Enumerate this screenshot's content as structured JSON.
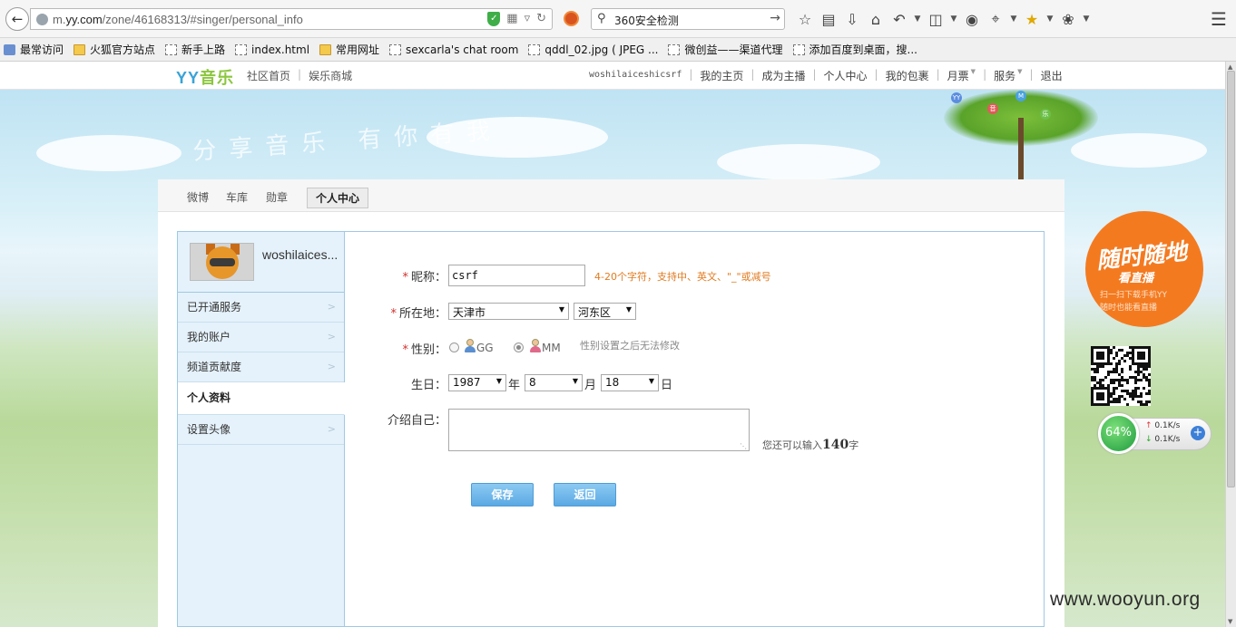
{
  "browser": {
    "url_prefix": "m.",
    "url_domain": "yy.com",
    "url_path": "/zone/46168313/#singer/personal_info",
    "search_text": "360安全检测",
    "bookmarks": [
      {
        "label": "最常访问",
        "icon": "star"
      },
      {
        "label": "火狐官方站点",
        "icon": "folder"
      },
      {
        "label": "新手上路",
        "icon": "page"
      },
      {
        "label": "index.html",
        "icon": "page"
      },
      {
        "label": "常用网址",
        "icon": "folder"
      },
      {
        "label": "sexcarla's chat room",
        "icon": "page"
      },
      {
        "label": "qddl_02.jpg ( JPEG ...",
        "icon": "page"
      },
      {
        "label": "微创益——渠道代理",
        "icon": "page"
      },
      {
        "label": "添加百度到桌面，搜...",
        "icon": "page"
      }
    ]
  },
  "site_nav": {
    "logo_main": "YY",
    "logo_sub": "音乐",
    "left_links": [
      "社区首页",
      "娱乐商城"
    ],
    "username": "woshilaiceshicsrf",
    "right_links": [
      "我的主页",
      "成为主播",
      "个人中心",
      "我的包裹",
      "月票",
      "服务",
      "退出"
    ]
  },
  "banner": {
    "heart_text": "分享音乐 有你有我"
  },
  "tabs": [
    "微博",
    "车库",
    "勋章",
    "个人中心"
  ],
  "sidebar": {
    "username": "woshilaices...",
    "items": [
      {
        "label": "已开通服务",
        "active": false
      },
      {
        "label": "我的账户",
        "active": false
      },
      {
        "label": "频道贡献度",
        "active": false
      },
      {
        "label": "个人资料",
        "active": true
      },
      {
        "label": "设置头像",
        "active": false
      }
    ]
  },
  "form": {
    "nickname_label": "昵称：",
    "nickname_value": "csrf",
    "nickname_hint": "4-20个字符，支持中、英文、\"_\"或减号",
    "location_label": "所在地：",
    "city": "天津市",
    "district": "河东区",
    "gender_label": "性别：",
    "gender_gg": "GG",
    "gender_mm": "MM",
    "gender_hint": "性别设置之后无法修改",
    "birthday_label": "生日：",
    "year": "1987",
    "year_unit": "年",
    "month": "8",
    "month_unit": "月",
    "day": "18",
    "day_unit": "日",
    "intro_label": "介绍自己：",
    "intro_counter_prefix": "您还可以输入",
    "intro_counter_value": "140",
    "intro_counter_suffix": "字",
    "save_label": "保存",
    "back_label": "返回"
  },
  "promo": {
    "title": "随时随地",
    "subtitle": "看直播",
    "desc_line1": "扫一扫下载手机YY",
    "desc_line2": "随时也能看直播"
  },
  "speed_widget": {
    "percent": "64%",
    "upload": "0.1K/s",
    "download": "0.1K/s"
  },
  "watermark": "www.wooyun.org"
}
